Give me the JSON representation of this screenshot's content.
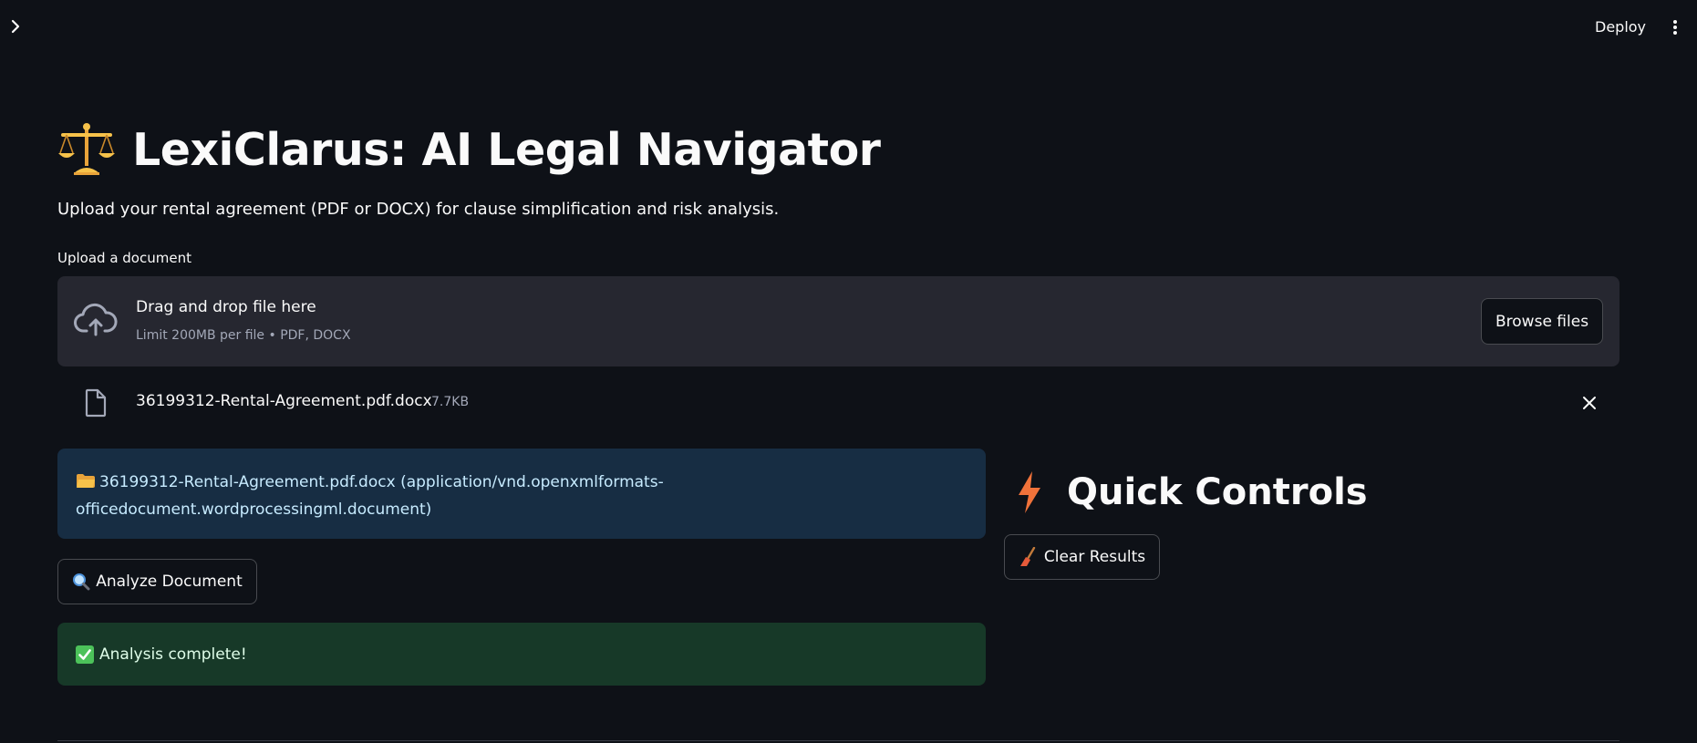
{
  "header": {
    "deploy_label": "Deploy"
  },
  "main": {
    "title": "LexiClarus: AI Legal Navigator",
    "title_icon": "balance-scale-icon",
    "subtitle": "Upload your rental agreement (PDF or DOCX) for clause simplification and risk analysis.",
    "uploader": {
      "label": "Upload a document",
      "drop_title": "Drag and drop file here",
      "limit_text": "Limit 200MB per file • PDF, DOCX",
      "browse_label": "Browse files"
    },
    "uploaded_file": {
      "name": "36199312-Rental-Agreement.pdf.docx",
      "size": "7.7KB"
    },
    "info_message": "36199312-Rental-Agreement.pdf.docx (application/vnd.openxmlformats-officedocument.wordprocessingml.document)",
    "analyze_label": "Analyze Document",
    "success_message": "Analysis complete!"
  },
  "quick_controls": {
    "title": "Quick Controls",
    "clear_label": "Clear Results"
  },
  "colors": {
    "background": "#0e1117",
    "dropzone": "#262730",
    "info_bg": "#172d43",
    "info_text": "#c7ebff",
    "success_bg": "#173928",
    "success_text": "#dffde9",
    "bolt": "#f0723a"
  }
}
